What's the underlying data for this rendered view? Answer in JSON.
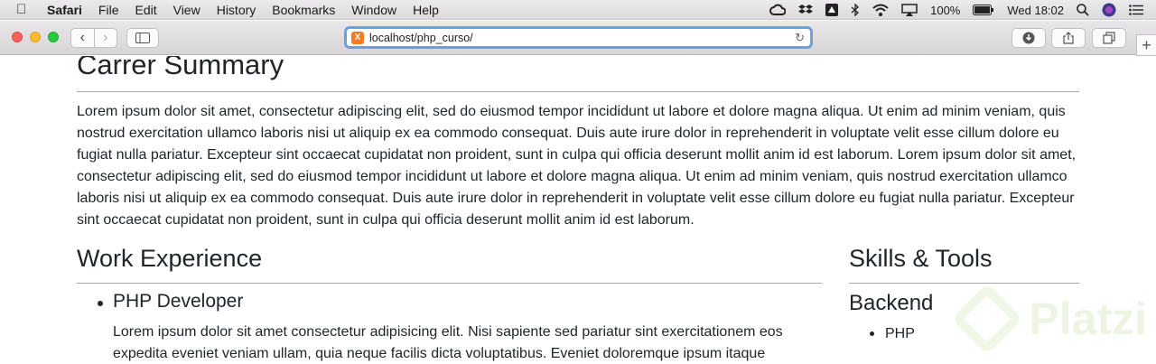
{
  "menubar": {
    "apple_icon": "apple-logo-icon",
    "app_name": "Safari",
    "items": [
      "File",
      "Edit",
      "View",
      "History",
      "Bookmarks",
      "Window",
      "Help"
    ],
    "battery_percent": "100%",
    "clock": "Wed 18:02"
  },
  "toolbar": {
    "url": "localhost/php_curso/",
    "accent_color": "#6aa0e0"
  },
  "page": {
    "summary_title": "Carrer Summary",
    "summary_text": "Lorem ipsum dolor sit amet, consectetur adipiscing elit, sed do eiusmod tempor incididunt ut labore et dolore magna aliqua. Ut enim ad minim veniam, quis nostrud exercitation ullamco laboris nisi ut aliquip ex ea commodo consequat. Duis aute irure dolor in reprehenderit in voluptate velit esse cillum dolore eu fugiat nulla pariatur. Excepteur sint occaecat cupidatat non proident, sunt in culpa qui officia deserunt mollit anim id est laborum. Lorem ipsum dolor sit amet, consectetur adipiscing elit, sed do eiusmod tempor incididunt ut labore et dolore magna aliqua. Ut enim ad minim veniam, quis nostrud exercitation ullamco laboris nisi ut aliquip ex ea commodo consequat. Duis aute irure dolor in reprehenderit in voluptate velit esse cillum dolore eu fugiat nulla pariatur. Excepteur sint occaecat cupidatat non proident, sunt in culpa qui officia deserunt mollit anim id est laborum.",
    "work_title": "Work Experience",
    "job_title": "PHP Developer",
    "job_desc": "Lorem ipsum dolor sit amet consectetur adipisicing elit. Nisi sapiente sed pariatur sint exercitationem eos expedita eveniet veniam ullam, quia neque facilis dicta voluptatibus. Eveniet doloremque ipsum itaque",
    "skills_title": "Skills & Tools",
    "backend_title": "Backend",
    "backend_items": [
      "PHP"
    ],
    "watermark": "Platzi"
  }
}
